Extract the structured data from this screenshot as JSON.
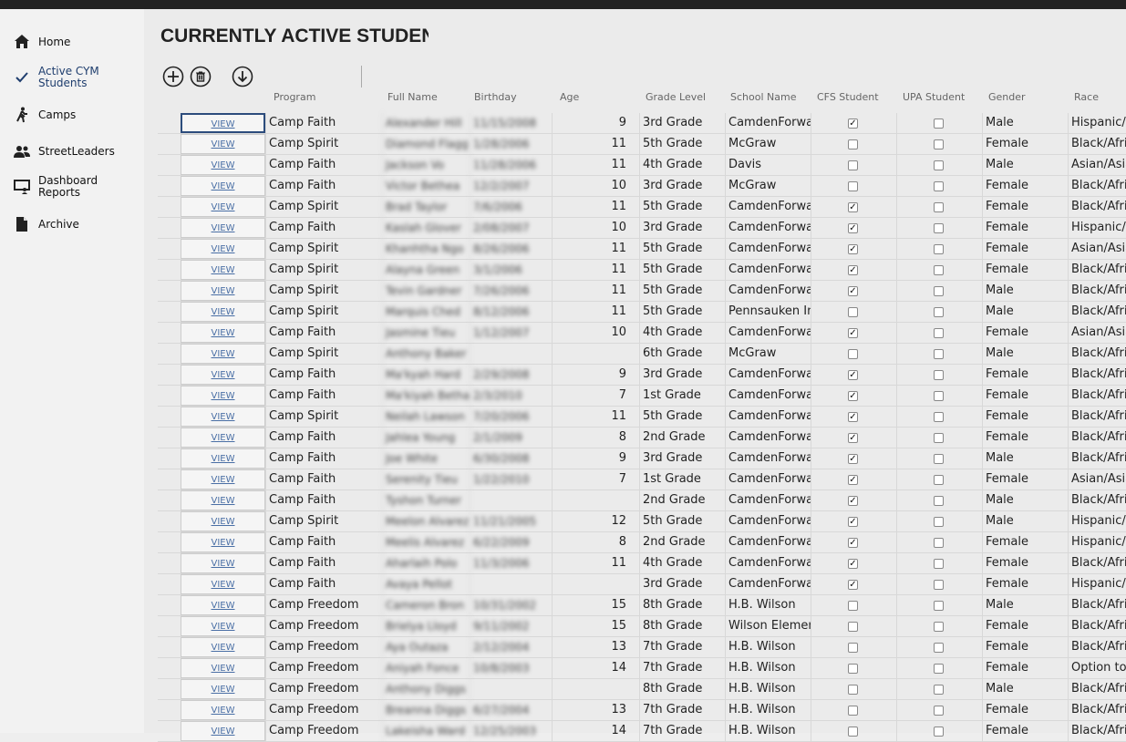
{
  "nav": [
    {
      "label": "Home",
      "icon": "home-icon",
      "active": false
    },
    {
      "label": "Active CYM Students",
      "icon": "check-icon",
      "active": true
    },
    {
      "label": "Camps",
      "icon": "walking-person-icon",
      "active": false
    },
    {
      "label": "StreetLeaders",
      "icon": "group-icon",
      "active": false
    },
    {
      "label": "Dashboard Reports",
      "icon": "presentation-icon",
      "active": false
    },
    {
      "label": "Archive",
      "icon": "document-icon",
      "active": false
    }
  ],
  "page_title": "CURRENTLY ACTIVE STUDENTS",
  "toolbar": {
    "add": "add-icon",
    "delete": "trash-icon",
    "download": "download-icon"
  },
  "columns": [
    "Program",
    "Full Name",
    "Birthday",
    "Age",
    "Grade Level",
    "School Name",
    "CFS Student",
    "UPA Student",
    "Gender",
    "Race"
  ],
  "view_label": "VIEW",
  "rows": [
    {
      "program": "Camp Faith",
      "name": "Alexander Hill",
      "birthday": "11/15/2008",
      "age": "9",
      "grade": "3rd Grade",
      "school": "CamdenForward",
      "cfs": true,
      "upa": false,
      "gender": "Male",
      "race": "Hispanic/Latino"
    },
    {
      "program": "Camp Spirit",
      "name": "Diamond Flagg",
      "birthday": "1/28/2006",
      "age": "11",
      "grade": "5th Grade",
      "school": "McGraw",
      "cfs": false,
      "upa": false,
      "gender": "Female",
      "race": "Black/African"
    },
    {
      "program": "Camp Faith",
      "name": "Jackson Vo",
      "birthday": "11/28/2006",
      "age": "11",
      "grade": "4th Grade",
      "school": "Davis",
      "cfs": false,
      "upa": false,
      "gender": "Male",
      "race": "Asian/Asian"
    },
    {
      "program": "Camp Faith",
      "name": "Victor Bethea",
      "birthday": "12/2/2007",
      "age": "10",
      "grade": "3rd Grade",
      "school": "McGraw",
      "cfs": false,
      "upa": false,
      "gender": "Female",
      "race": "Black/African"
    },
    {
      "program": "Camp Spirit",
      "name": "Brad Taylor",
      "birthday": "7/6/2006",
      "age": "11",
      "grade": "5th Grade",
      "school": "CamdenForward",
      "cfs": true,
      "upa": false,
      "gender": "Female",
      "race": "Black/African"
    },
    {
      "program": "Camp Faith",
      "name": "Kaslah Glover",
      "birthday": "2/08/2007",
      "age": "10",
      "grade": "3rd Grade",
      "school": "CamdenForward",
      "cfs": true,
      "upa": false,
      "gender": "Female",
      "race": "Hispanic/Latino"
    },
    {
      "program": "Camp Spirit",
      "name": "Khanhtha Ngo",
      "birthday": "8/26/2006",
      "age": "11",
      "grade": "5th Grade",
      "school": "CamdenForward",
      "cfs": true,
      "upa": false,
      "gender": "Female",
      "race": "Asian/Asian"
    },
    {
      "program": "Camp Spirit",
      "name": "Alayna Green",
      "birthday": "3/1/2006",
      "age": "11",
      "grade": "5th Grade",
      "school": "CamdenForward",
      "cfs": true,
      "upa": false,
      "gender": "Female",
      "race": "Black/African"
    },
    {
      "program": "Camp Spirit",
      "name": "Tevin Gardner",
      "birthday": "7/26/2006",
      "age": "11",
      "grade": "5th Grade",
      "school": "CamdenForward",
      "cfs": true,
      "upa": false,
      "gender": "Male",
      "race": "Black/African"
    },
    {
      "program": "Camp Spirit",
      "name": "Marquis Ched",
      "birthday": "8/12/2006",
      "age": "11",
      "grade": "5th Grade",
      "school": "Pennsauken Intermediate",
      "cfs": false,
      "upa": false,
      "gender": "Male",
      "race": "Black/African"
    },
    {
      "program": "Camp Faith",
      "name": "Jasmine Tieu",
      "birthday": "1/12/2007",
      "age": "10",
      "grade": "4th Grade",
      "school": "CamdenForward",
      "cfs": true,
      "upa": false,
      "gender": "Female",
      "race": "Asian/Asian"
    },
    {
      "program": "Camp Spirit",
      "name": "Anthony Baker",
      "birthday": "",
      "age": "",
      "grade": "6th Grade",
      "school": "McGraw",
      "cfs": false,
      "upa": false,
      "gender": "Male",
      "race": "Black/African"
    },
    {
      "program": "Camp Faith",
      "name": "Ma'kyah Hard",
      "birthday": "2/29/2008",
      "age": "9",
      "grade": "3rd Grade",
      "school": "CamdenForward",
      "cfs": true,
      "upa": false,
      "gender": "Female",
      "race": "Black/African"
    },
    {
      "program": "Camp Faith",
      "name": "Ma'kiyah Betha",
      "birthday": "2/3/2010",
      "age": "7",
      "grade": "1st Grade",
      "school": "CamdenForward",
      "cfs": true,
      "upa": false,
      "gender": "Female",
      "race": "Black/African"
    },
    {
      "program": "Camp Spirit",
      "name": "Neilah Lawson",
      "birthday": "7/20/2006",
      "age": "11",
      "grade": "5th Grade",
      "school": "CamdenForward",
      "cfs": true,
      "upa": false,
      "gender": "Female",
      "race": "Black/African"
    },
    {
      "program": "Camp Faith",
      "name": "Jahlea Young",
      "birthday": "2/1/2009",
      "age": "8",
      "grade": "2nd Grade",
      "school": "CamdenForward",
      "cfs": true,
      "upa": false,
      "gender": "Female",
      "race": "Black/African"
    },
    {
      "program": "Camp Faith",
      "name": "Joe White",
      "birthday": "6/30/2008",
      "age": "9",
      "grade": "3rd Grade",
      "school": "CamdenForward",
      "cfs": true,
      "upa": false,
      "gender": "Male",
      "race": "Black/African"
    },
    {
      "program": "Camp Faith",
      "name": "Serenity Tieu",
      "birthday": "1/22/2010",
      "age": "7",
      "grade": "1st Grade",
      "school": "CamdenForward",
      "cfs": true,
      "upa": false,
      "gender": "Female",
      "race": "Asian/Asian"
    },
    {
      "program": "Camp Faith",
      "name": "Tyshon Turner",
      "birthday": "",
      "age": "",
      "grade": "2nd Grade",
      "school": "CamdenForward",
      "cfs": true,
      "upa": false,
      "gender": "Male",
      "race": "Black/African"
    },
    {
      "program": "Camp Spirit",
      "name": "Meelon Alvarez",
      "birthday": "11/21/2005",
      "age": "12",
      "grade": "5th Grade",
      "school": "CamdenForward",
      "cfs": true,
      "upa": false,
      "gender": "Male",
      "race": "Hispanic/Latino"
    },
    {
      "program": "Camp Faith",
      "name": "Meelis Alvarez",
      "birthday": "6/22/2009",
      "age": "8",
      "grade": "2nd Grade",
      "school": "CamdenForward",
      "cfs": true,
      "upa": false,
      "gender": "Female",
      "race": "Hispanic/Latino"
    },
    {
      "program": "Camp Faith",
      "name": "Aharlaih Polo",
      "birthday": "11/3/2006",
      "age": "11",
      "grade": "4th Grade",
      "school": "CamdenForward",
      "cfs": true,
      "upa": false,
      "gender": "Female",
      "race": "Black/African"
    },
    {
      "program": "Camp Faith",
      "name": "Avaya Pellot",
      "birthday": "",
      "age": "",
      "grade": "3rd Grade",
      "school": "CamdenForward",
      "cfs": true,
      "upa": false,
      "gender": "Female",
      "race": "Hispanic/Latino"
    },
    {
      "program": "Camp Freedom",
      "name": "Cameron Bron",
      "birthday": "10/31/2002",
      "age": "15",
      "grade": "8th Grade",
      "school": "H.B. Wilson",
      "cfs": false,
      "upa": false,
      "gender": "Male",
      "race": "Black/African"
    },
    {
      "program": "Camp Freedom",
      "name": "Brielya Lloyd",
      "birthday": "9/11/2002",
      "age": "15",
      "grade": "8th Grade",
      "school": "Wilson Elementary",
      "cfs": false,
      "upa": false,
      "gender": "Female",
      "race": "Black/African"
    },
    {
      "program": "Camp Freedom",
      "name": "Aya Outaza",
      "birthday": "2/12/2004",
      "age": "13",
      "grade": "7th Grade",
      "school": "H.B. Wilson",
      "cfs": false,
      "upa": false,
      "gender": "Female",
      "race": "Black/African"
    },
    {
      "program": "Camp Freedom",
      "name": "Aniyah Fonce",
      "birthday": "10/8/2003",
      "age": "14",
      "grade": "7th Grade",
      "school": "H.B. Wilson",
      "cfs": false,
      "upa": false,
      "gender": "Female",
      "race": "Option to"
    },
    {
      "program": "Camp Freedom",
      "name": "Anthony Diggs",
      "birthday": "",
      "age": "",
      "grade": "8th Grade",
      "school": "H.B. Wilson",
      "cfs": false,
      "upa": false,
      "gender": "Male",
      "race": "Black/African"
    },
    {
      "program": "Camp Freedom",
      "name": "Breanna Diggs",
      "birthday": "6/27/2004",
      "age": "13",
      "grade": "7th Grade",
      "school": "H.B. Wilson",
      "cfs": false,
      "upa": false,
      "gender": "Female",
      "race": "Black/African"
    },
    {
      "program": "Camp Freedom",
      "name": "Lakeisha Ward",
      "birthday": "12/25/2003",
      "age": "14",
      "grade": "7th Grade",
      "school": "H.B. Wilson",
      "cfs": false,
      "upa": false,
      "gender": "Female",
      "race": "Black/African"
    }
  ]
}
